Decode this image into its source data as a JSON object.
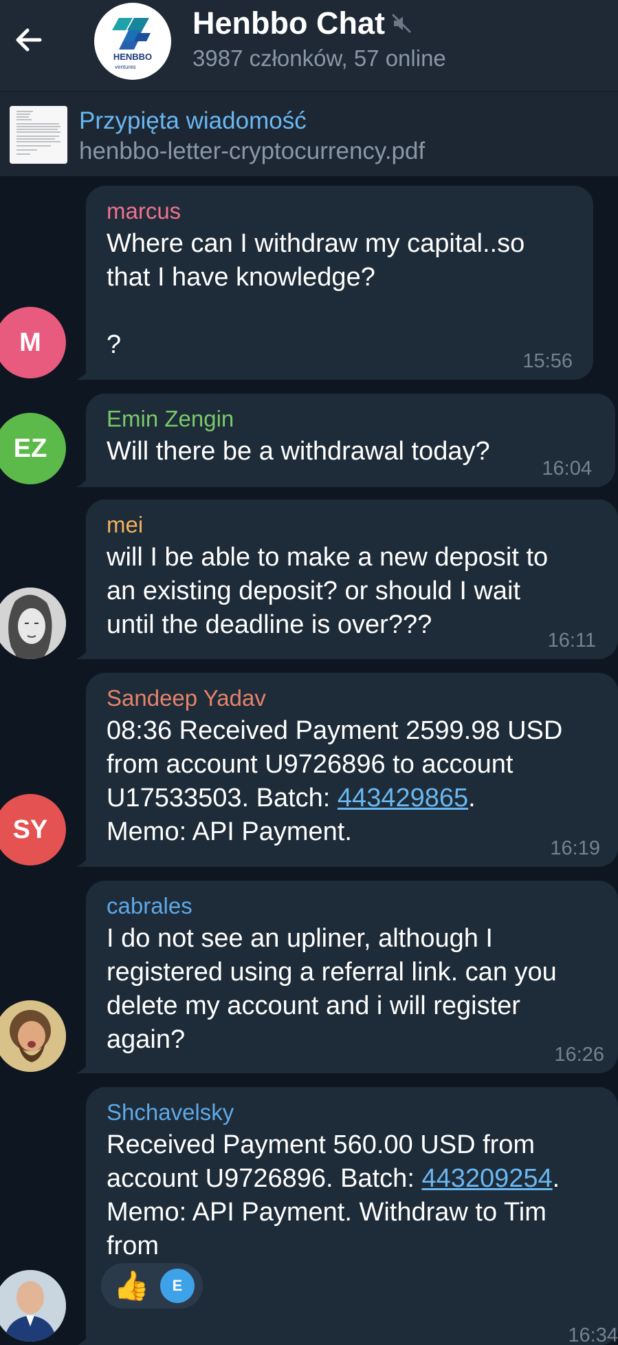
{
  "header": {
    "title": "Henbbo Chat",
    "subtitle": "3987 członków, 57 online",
    "logo_text": "HENBBO",
    "logo_sub": "ventures"
  },
  "pinned": {
    "title": "Przypięta wiadomość",
    "file": "henbbo-letter-cryptocurrency.pdf"
  },
  "messages": [
    {
      "sender": "marcus",
      "sender_color": "#f1728f",
      "text": "Where can I withdraw my capital..so\nthat I have knowledge?\n\n?",
      "time": "15:56",
      "avatar_initials": "M",
      "avatar_color": "#e85a7e"
    },
    {
      "sender": "Emin Zengin",
      "sender_color": "#7ac96a",
      "text": "Will there be a withdrawal today?",
      "time": "16:04",
      "avatar_initials": "EZ",
      "avatar_color": "#5cba4a"
    },
    {
      "sender": "mei",
      "sender_color": "#f3b15e",
      "text": "will I be able to make a new deposit to\nan existing deposit? or should I wait\nuntil the deadline is over???",
      "time": "16:11"
    },
    {
      "sender": "Sandeep Yadav",
      "sender_color": "#e5846b",
      "text_before": "08:36 Received Payment 2599.98 USD\nfrom account U9726896 to account\nU17533503. Batch: ",
      "link": "443429865",
      "text_after": ".\nMemo: API Payment.",
      "time": "16:19",
      "avatar_initials": "SY",
      "avatar_color": "#e45252"
    },
    {
      "sender": "cabrales",
      "sender_color": "#5ea9e8",
      "text": "I do not see an upliner, although I\nregistered using a referral link. can you\ndelete my account and i will register\nagain?",
      "time": "16:26"
    },
    {
      "sender": "Shchavelsky",
      "sender_color": "#5ea9e8",
      "text_before": "Received Payment 560.00 USD from\naccount U9726896. Batch: ",
      "link": "443209254",
      "text_after": ".\nMemo: API Payment. Withdraw to Tim\nfrom",
      "time": "16:34",
      "reaction_emoji": "👍",
      "reaction_avatar": "E"
    }
  ]
}
